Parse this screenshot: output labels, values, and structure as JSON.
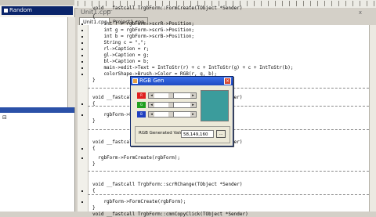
{
  "inspector": {
    "selected_property": "Random"
  },
  "editor_window": {
    "title": "Unit1.cpp",
    "close": "x"
  },
  "file_tabs": [
    "Unit1.cpp",
    "Project1.cpp"
  ],
  "code_lines": [
    "void __fastcall TrgbForm::FormCreate(TObject *Sender)",
    "{",
    "    int r = rgbForm->scrR->Position;",
    "    int g = rgbForm->scrG->Position;",
    "    int b = rgbForm->scrB->Position;",
    "    String c = \",\";",
    "    rl->Caption = r;",
    "    gl->Caption = g;",
    "    bl->Caption = b;",
    "    main->edit->Text = IntToStr(r) + c + IntToStr(g) + c + IntToStr(b);",
    "    colorShape->Brush->Color = RGB(r, g, b);",
    "}",
    "void __fastcall TrgbForm::scrGChange(TObject *Sender)",
    "{",
    "    rgbForm->FormCreate(rgbForm);",
    "}",
    "void __fastcall TrgbForm::scrBChange(TObject *Sender)",
    "{",
    "  rgbForm->FormCreate(rgbForm);",
    "}",
    "void __fastcall TrgbForm::scrRChange(TObject *Sender)",
    "{",
    "    rgbForm->FormCreate(rgbForm);",
    "}",
    "void __fastcall TrgbForm::cmnCopyClick(TObject *Sender)"
  ],
  "dialog": {
    "title": "RGB Gen",
    "channels": [
      {
        "label": "R",
        "color": "#e02020",
        "level": 0.45
      },
      {
        "label": "G",
        "color": "#20a020",
        "level": 0.45
      },
      {
        "label": "B",
        "color": "#2040c0",
        "level": 0.45
      }
    ],
    "preview_color": "#3b9c9c",
    "generated_label": "RGB Generated Value",
    "generated_value": "58,149,160",
    "copy_button": "..."
  },
  "colors": {
    "selection": "#0a246a",
    "dialog_title": "#1e49c2"
  }
}
